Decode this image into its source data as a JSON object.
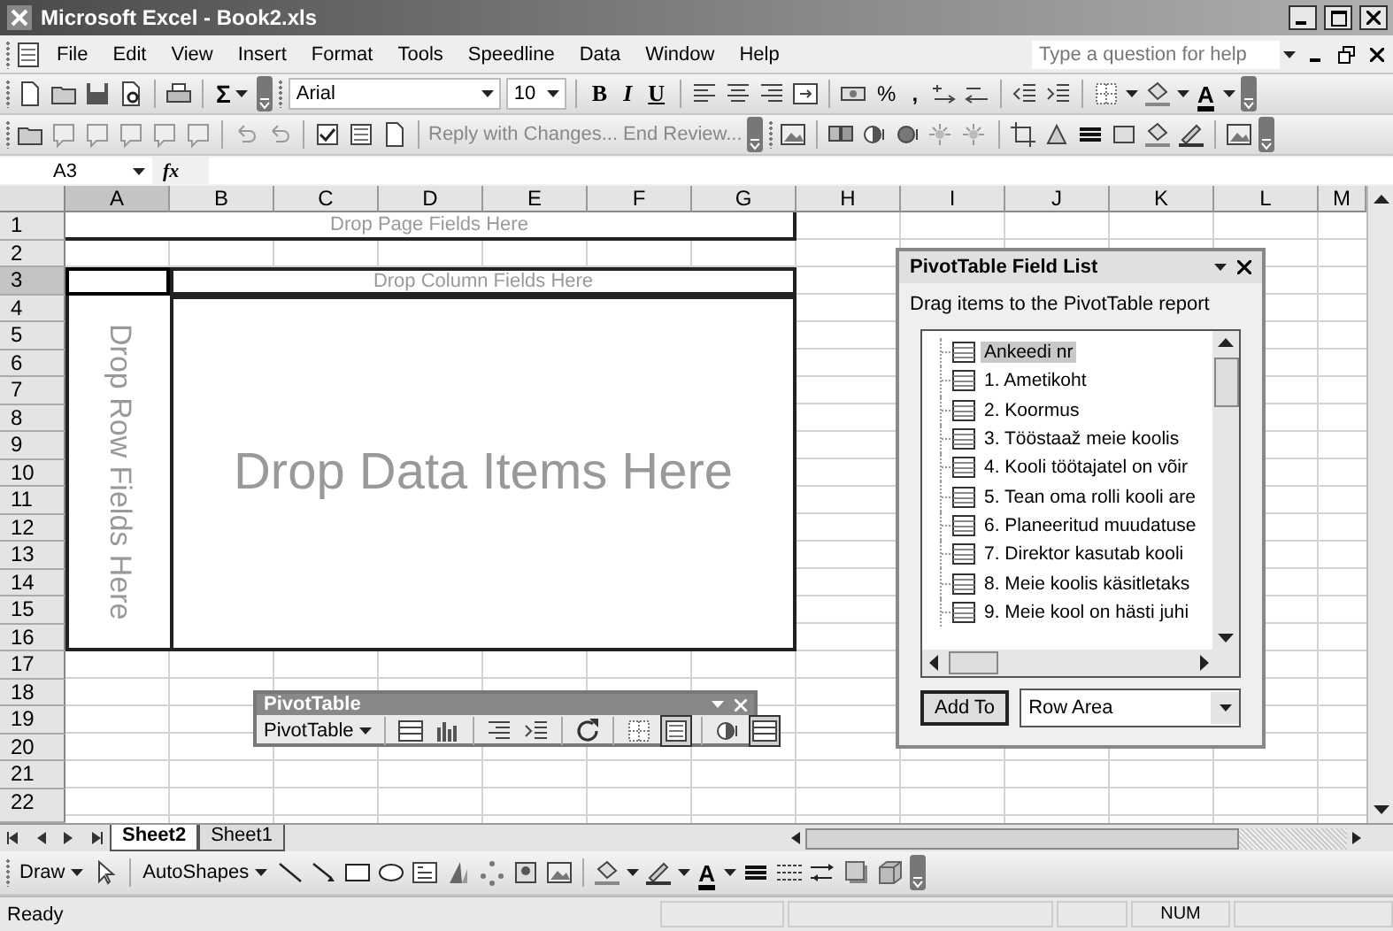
{
  "window": {
    "title": "Microsoft Excel - Book2.xls"
  },
  "menu": [
    "File",
    "Edit",
    "View",
    "Insert",
    "Format",
    "Tools",
    "Speedline",
    "Data",
    "Window",
    "Help"
  ],
  "help_box": {
    "placeholder": "Type a question for help"
  },
  "formatting": {
    "autosum": "Σ",
    "font": "Arial",
    "font_size": "10",
    "styles": [
      "B",
      "I",
      "U"
    ],
    "percent": "%",
    "comma": ",",
    "font_color": "A"
  },
  "reviewing": {
    "reply": "Reply with Changes...",
    "end_review": "End Review..."
  },
  "formula_bar": {
    "name_box": "A3",
    "fx": "fx"
  },
  "sheet": {
    "columns": [
      {
        "label": "A",
        "selected": true
      },
      {
        "label": "B",
        "selected": false
      },
      {
        "label": "C",
        "selected": false
      },
      {
        "label": "D",
        "selected": false
      },
      {
        "label": "E",
        "selected": false
      },
      {
        "label": "F",
        "selected": false
      },
      {
        "label": "G",
        "selected": false
      },
      {
        "label": "H",
        "selected": false
      },
      {
        "label": "I",
        "selected": false
      },
      {
        "label": "J",
        "selected": false
      },
      {
        "label": "K",
        "selected": false
      },
      {
        "label": "L",
        "selected": false
      },
      {
        "label": "M",
        "selected": false
      }
    ],
    "rows": [
      {
        "label": "1",
        "selected": false
      },
      {
        "label": "2",
        "selected": false
      },
      {
        "label": "3",
        "selected": true
      },
      {
        "label": "4",
        "selected": false
      },
      {
        "label": "5",
        "selected": false
      },
      {
        "label": "6",
        "selected": false
      },
      {
        "label": "7",
        "selected": false
      },
      {
        "label": "8",
        "selected": false
      },
      {
        "label": "9",
        "selected": false
      },
      {
        "label": "10",
        "selected": false
      },
      {
        "label": "11",
        "selected": false
      },
      {
        "label": "12",
        "selected": false
      },
      {
        "label": "13",
        "selected": false
      },
      {
        "label": "14",
        "selected": false
      },
      {
        "label": "15",
        "selected": false
      },
      {
        "label": "16",
        "selected": false
      },
      {
        "label": "17",
        "selected": false
      },
      {
        "label": "18",
        "selected": false
      },
      {
        "label": "19",
        "selected": false
      },
      {
        "label": "20",
        "selected": false
      },
      {
        "label": "21",
        "selected": false
      },
      {
        "label": "22",
        "selected": false
      }
    ],
    "page_area": "Drop Page Fields Here",
    "column_area": "Drop Column Fields Here",
    "row_area": "Drop Row Fields Here",
    "data_area": "Drop Data Items Here"
  },
  "field_list": {
    "title": "PivotTable Field List",
    "hint": "Drag items to the PivotTable report",
    "fields": [
      {
        "label": "Ankeedi nr",
        "selected": true
      },
      {
        "label": "1. Ametikoht",
        "selected": false
      },
      {
        "label": "2. Koormus",
        "selected": false
      },
      {
        "label": "3. Tööstaaž meie koolis",
        "selected": false
      },
      {
        "label": "4. Kooli töötajatel on võir",
        "selected": false
      },
      {
        "label": "5. Tean oma rolli kooli are",
        "selected": false
      },
      {
        "label": "6. Planeeritud muudatuse",
        "selected": false
      },
      {
        "label": "7. Direktor kasutab kooli",
        "selected": false
      },
      {
        "label": "8. Meie koolis käsitletaks",
        "selected": false
      },
      {
        "label": "9. Meie kool on hästi juhi",
        "selected": false
      }
    ],
    "add_button": "Add To",
    "area": "Row Area"
  },
  "pivot_toolbar": {
    "title": "PivotTable",
    "menu": "PivotTable",
    "buttons": [
      {
        "pressed": false
      },
      {
        "pressed": false
      },
      {
        "pressed": false
      },
      {
        "pressed": false
      },
      {
        "pressed": false
      },
      {
        "pressed": false
      },
      {
        "pressed": true
      },
      {
        "pressed": false
      },
      {
        "pressed": true
      }
    ]
  },
  "sheet_tabs": [
    {
      "label": "Sheet2",
      "selected": true
    },
    {
      "label": "Sheet1",
      "selected": false
    }
  ],
  "drawing": {
    "draw": "Draw",
    "autoshapes": "AutoShapes",
    "font_color": "A"
  },
  "status_bar": {
    "message": "Ready",
    "indicators": [
      "NUM"
    ]
  }
}
